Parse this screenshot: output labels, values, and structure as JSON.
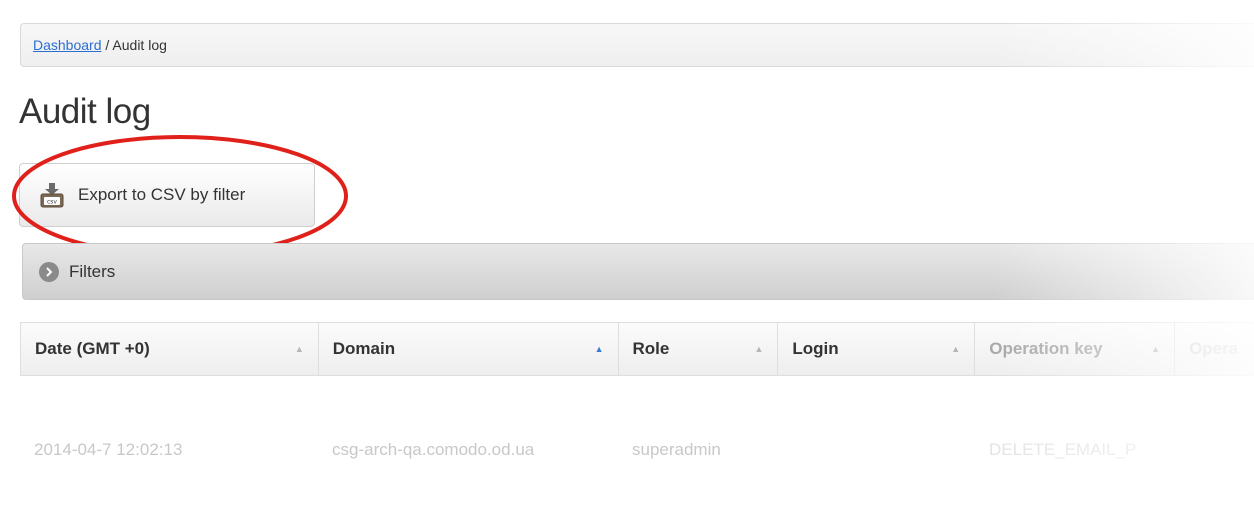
{
  "breadcrumb": {
    "link": "Dashboard",
    "separator": " / ",
    "current": "Audit log"
  },
  "page_title": "Audit log",
  "export_button": {
    "label": "Export to CSV by filter",
    "icon": "csv-download-icon"
  },
  "filters": {
    "label": "Filters",
    "icon": "chevron-right-icon"
  },
  "table": {
    "columns": [
      {
        "label": "Date (GMT +0)"
      },
      {
        "label": "Domain"
      },
      {
        "label": "Role"
      },
      {
        "label": "Login"
      },
      {
        "label": "Operation key"
      },
      {
        "label": "Opera"
      }
    ],
    "rows": [
      {
        "date": "2014-04-7 12:02:13",
        "domain": "csg-arch-qa.comodo.od.ua",
        "role": "superadmin",
        "login": "",
        "operation_key": "DELETE_EMAIL_P"
      }
    ]
  },
  "colors": {
    "link": "#2a6fd0",
    "sort_active": "#3a7bd5",
    "highlight": "#e0201a"
  }
}
